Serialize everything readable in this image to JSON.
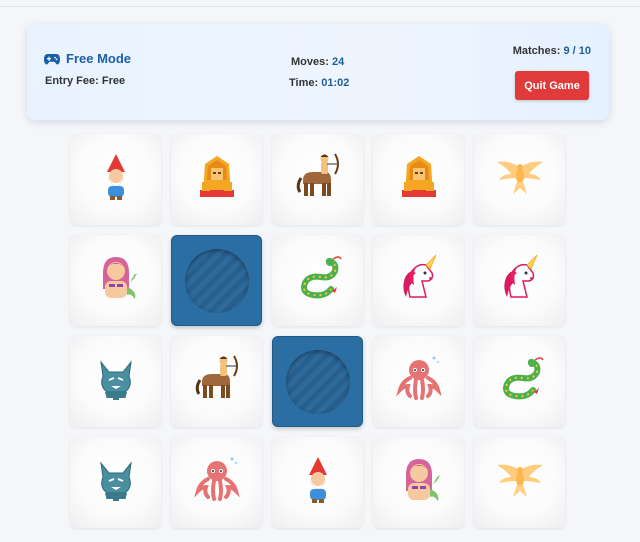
{
  "header": {
    "mode_icon": "gamepad-icon",
    "mode_title": "Free Mode",
    "entry_label": "Entry Fee:",
    "entry_value": "Free",
    "moves_label": "Moves:",
    "moves_value": "24",
    "time_label": "Time:",
    "time_value": "01:02",
    "matches_label": "Matches:",
    "matches_value": "9 / 10",
    "quit_label": "Quit Game"
  },
  "colors": {
    "accent": "#1b5fa8",
    "quit": "#e03a3a",
    "card_back": "#2b6ea3"
  },
  "board": {
    "columns": 5,
    "rows": [
      [
        "gnome",
        "sphinx",
        "centaur",
        "sphinx",
        "phoenix"
      ],
      [
        "mermaid",
        "hidden",
        "dragon",
        "unicorn",
        "unicorn"
      ],
      [
        "werewolf",
        "centaur",
        "hidden",
        "kraken",
        "dragon"
      ],
      [
        "werewolf",
        "kraken",
        "gnome",
        "mermaid",
        "phoenix"
      ]
    ]
  }
}
